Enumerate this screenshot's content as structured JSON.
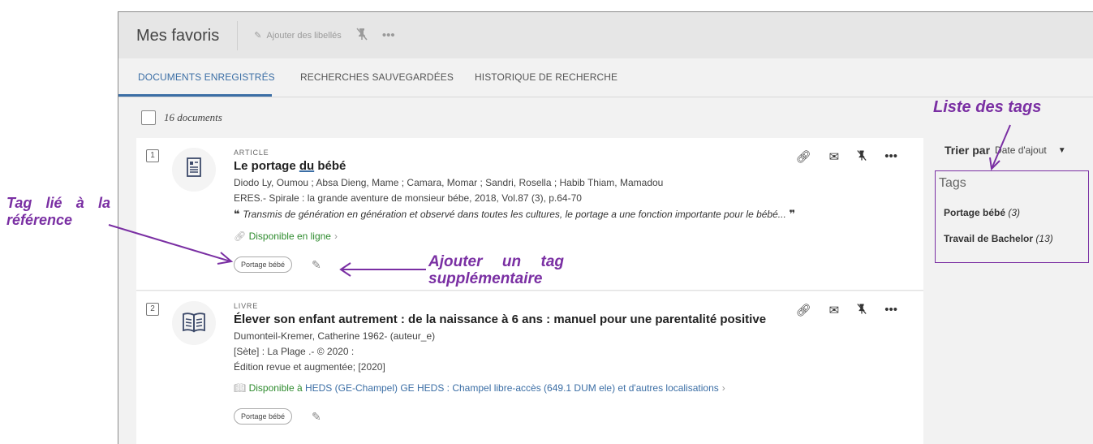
{
  "header": {
    "title": "Mes favoris",
    "add_labels": "Ajouter des libellés",
    "unpin_icon": "unpin-icon",
    "more_icon": "ellipsis-icon"
  },
  "tabs": [
    {
      "label": "DOCUMENTS ENREGISTRÉS",
      "active": true
    },
    {
      "label": "RECHERCHES SAUVEGARDÉES",
      "active": false
    },
    {
      "label": "HISTORIQUE DE RECHERCHE",
      "active": false
    }
  ],
  "list": {
    "count": "16 documents"
  },
  "records": [
    {
      "num": "1",
      "type": "ARTICLE",
      "title_a": "Le portage ",
      "title_u": "du",
      "title_b": " bébé",
      "authors": "Diodo Ly, Oumou ; Absa Dieng, Mame ; Camara, Momar ; Sandri, Rosella ; Habib Thiam, Mamadou",
      "source": "ERES.- Spirale : la grande aventure de monsieur bébe, 2018, Vol.87 (3), p.64-70",
      "quote": "Transmis de génération en génération et observé dans toutes les cultures, le portage a une fonction importante pour le bébé...",
      "availability": "Disponible en ligne",
      "tag": "Portage bébé"
    },
    {
      "num": "2",
      "type": "LIVRE",
      "title": "Élever son enfant autrement : de la naissance à 6 ans : manuel pour une parentalité positive",
      "author": "Dumonteil-Kremer, Catherine 1962- (auteur_e)",
      "publisher": "[Sète] : La Plage .- © 2020 :",
      "edition": "Édition revue et augmentée; [2020]",
      "avail_prefix": "Disponible à",
      "avail_location": "HEDS (GE-Champel)  GE HEDS : Champel libre-accès (649.1 DUM ele) et d'autres localisations",
      "tag": "Portage bébé"
    }
  ],
  "sidebar": {
    "sort_label": "Trier par",
    "sort_value": "Date d'ajout",
    "tags_title": "Tags",
    "tags": [
      {
        "name": "Portage bébé",
        "count": "(3)"
      },
      {
        "name": "Travail de Bachelor",
        "count": "(13)"
      }
    ]
  },
  "annotations": {
    "tag_ref_l1": "Tag lié à la",
    "tag_ref_l2": "référence",
    "ajouter_l1": "Ajouter un tag",
    "ajouter_l2": "supplémentaire",
    "liste": "Liste des tags"
  },
  "colors": {
    "annotation": "#7a2fa3",
    "accent": "#3b6ea5",
    "available": "#2e8b2e"
  }
}
